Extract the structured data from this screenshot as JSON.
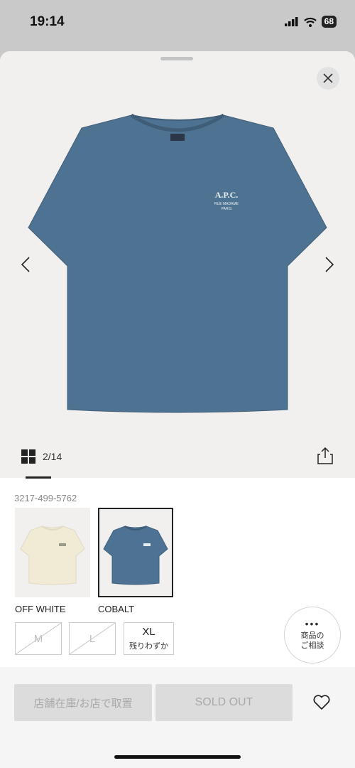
{
  "status_bar": {
    "time": "19:14",
    "battery": "68"
  },
  "gallery": {
    "counter": "2/14",
    "image_index": 2,
    "image_total": 14
  },
  "product_print": {
    "brand": "A.P.C.",
    "line1": "RUE MADAME",
    "line2": "PARIS"
  },
  "product": {
    "sku": "3217-499-5762"
  },
  "colors": [
    {
      "label": "OFF WHITE",
      "selected": false,
      "swatch": "#f1ebd6"
    },
    {
      "label": "COBALT",
      "selected": true,
      "swatch": "#4d7293"
    }
  ],
  "sizes": [
    {
      "label": "M",
      "available": false,
      "note": ""
    },
    {
      "label": "L",
      "available": false,
      "note": ""
    },
    {
      "label": "XL",
      "available": true,
      "note": "残りわずか"
    }
  ],
  "consult": {
    "line1": "商品の",
    "line2": "ご相談"
  },
  "footer": {
    "store_button": "店舗在庫/お店で取置",
    "soldout_button": "SOLD OUT"
  },
  "colors_theme": {
    "accent": "#222222",
    "disabled_text": "#a9a9a9",
    "disabled_bg": "#dcdcdc"
  }
}
